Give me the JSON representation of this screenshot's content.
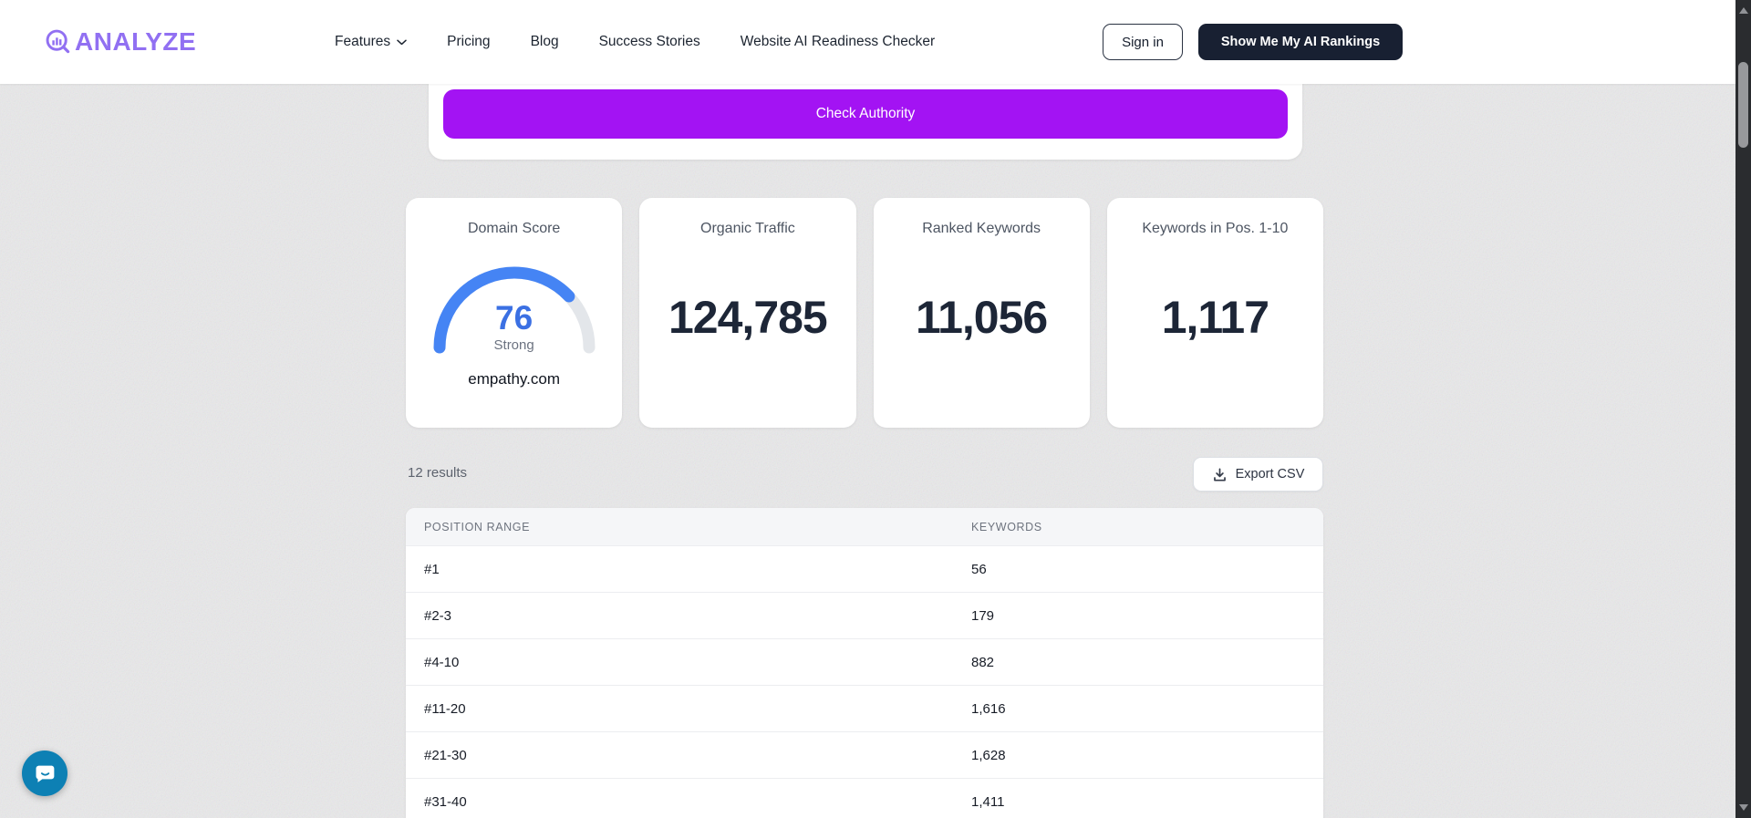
{
  "nav": {
    "logo_text": "ANALYZE",
    "items": [
      {
        "label": "Features",
        "has_dropdown": true
      },
      {
        "label": "Pricing",
        "has_dropdown": false
      },
      {
        "label": "Blog",
        "has_dropdown": false
      },
      {
        "label": "Success Stories",
        "has_dropdown": false
      },
      {
        "label": "Website AI Readiness Checker",
        "has_dropdown": false
      }
    ],
    "sign_in_label": "Sign in",
    "cta_label": "Show Me My AI Rankings"
  },
  "authority_form": {
    "submit_label": "Check Authority"
  },
  "metrics": {
    "domain_score": {
      "title": "Domain Score",
      "score": "76",
      "score_value": 76,
      "max": 100,
      "rating": "Strong",
      "domain": "empathy.com"
    },
    "cards": [
      {
        "title": "Organic Traffic",
        "value": "124,785"
      },
      {
        "title": "Ranked Keywords",
        "value": "11,056"
      },
      {
        "title": "Keywords in Pos. 1-10",
        "value": "1,117"
      }
    ]
  },
  "results_bar": {
    "count_label": "12 results",
    "export_label": "Export CSV"
  },
  "table": {
    "headers": [
      "POSITION RANGE",
      "KEYWORDS"
    ],
    "rows": [
      {
        "position_range": "#1",
        "keywords": "56"
      },
      {
        "position_range": "#2-3",
        "keywords": "179"
      },
      {
        "position_range": "#4-10",
        "keywords": "882"
      },
      {
        "position_range": "#11-20",
        "keywords": "1,616"
      },
      {
        "position_range": "#21-30",
        "keywords": "1,628"
      },
      {
        "position_range": "#31-40",
        "keywords": "1,411"
      }
    ]
  },
  "icons": {
    "logo": "magnifier-chart-icon",
    "nav_dropdown": "chevron-down-icon",
    "export": "download-icon",
    "chat": "chat-bubble-icon",
    "scrollbar": [
      "triangle-up-icon",
      "triangle-down-icon"
    ]
  },
  "colors": {
    "accent_purple": "#a313f3",
    "brand_purple": "#9170f2",
    "dark_navy": "#182032",
    "gauge_blue": "#4584f4",
    "gauge_track": "#e3e6ea",
    "score_blue": "#3b70e3",
    "chat_blue": "#0d80b4"
  }
}
